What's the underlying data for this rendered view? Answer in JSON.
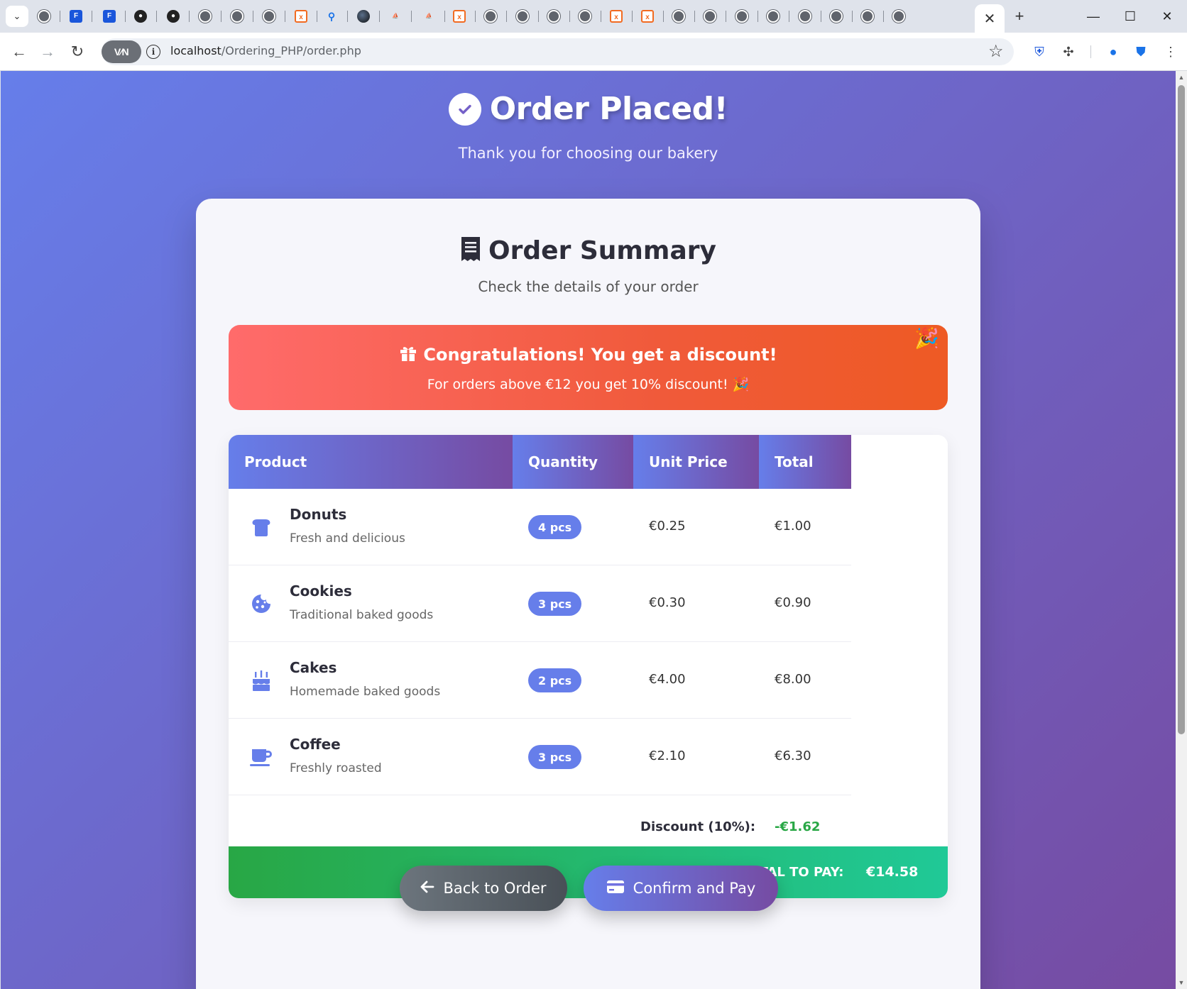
{
  "browser": {
    "active_tab_close": "✕",
    "new_tab": "+",
    "vpn_label": "V⁄N",
    "url_host": "localhost",
    "url_path": "/Ordering_PHP/order.php"
  },
  "hero": {
    "title": "Order Placed!",
    "subtitle": "Thank you for choosing our bakery"
  },
  "summary": {
    "title": "Order Summary",
    "subtitle": "Check the details of your order"
  },
  "discount_banner": {
    "title": "Congratulations! You get a discount!",
    "message": "For orders above €12 you get 10% discount! 🎉"
  },
  "table": {
    "headers": {
      "product": "Product",
      "quantity": "Quantity",
      "unit_price": "Unit Price",
      "total": "Total"
    },
    "rows": [
      {
        "icon": "bread-icon",
        "name": "Donuts",
        "description": "Fresh and delicious",
        "quantity": "4 pcs",
        "unit_price": "€0.25",
        "total": "€1.00"
      },
      {
        "icon": "cookie-icon",
        "name": "Cookies",
        "description": "Traditional baked goods",
        "quantity": "3 pcs",
        "unit_price": "€0.30",
        "total": "€0.90"
      },
      {
        "icon": "birthday-cake-icon",
        "name": "Cakes",
        "description": "Homemade baked goods",
        "quantity": "2 pcs",
        "unit_price": "€4.00",
        "total": "€8.00"
      },
      {
        "icon": "coffee-cup-icon",
        "name": "Coffee",
        "description": "Freshly roasted",
        "quantity": "3 pcs",
        "unit_price": "€2.10",
        "total": "€6.30"
      }
    ],
    "discount_label": "Discount (10%):",
    "discount_value": "-€1.62",
    "total_label": "TOTAL TO PAY:",
    "total_value": "€14.58"
  },
  "buttons": {
    "back": "Back to Order",
    "confirm": "Confirm and Pay"
  },
  "colors": {
    "gradient_start": "#667eea",
    "gradient_end": "#764ba2",
    "discount_banner": "#ee5a24",
    "total_bar": "#28a745",
    "discount_text": "#28a745"
  }
}
